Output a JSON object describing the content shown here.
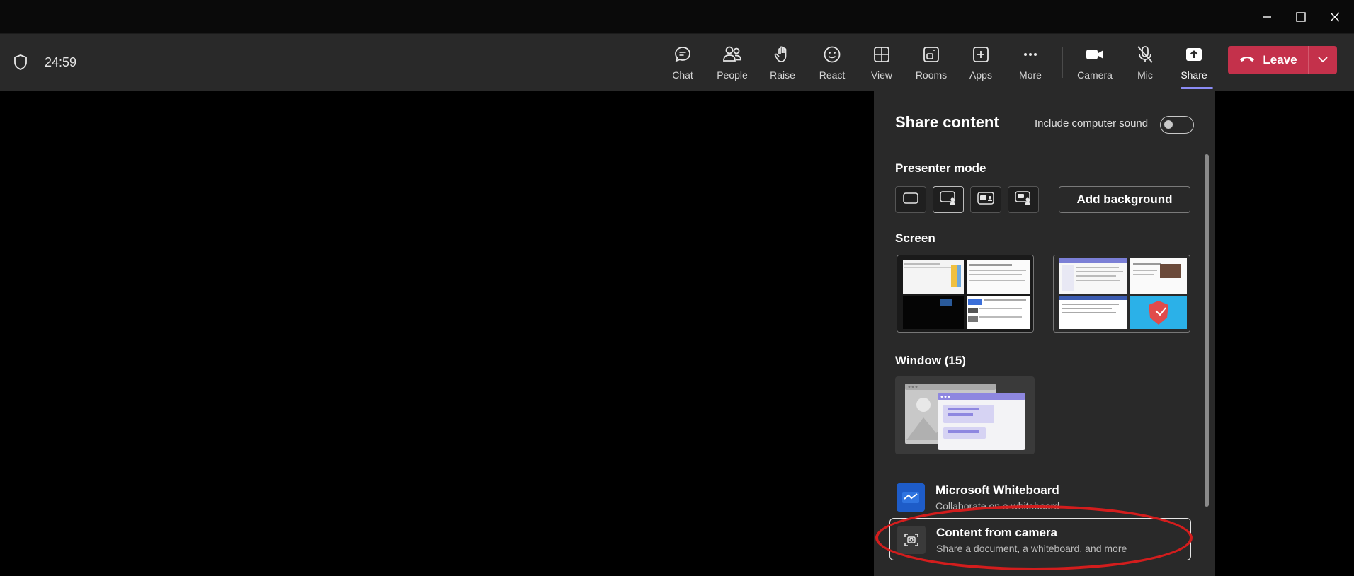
{
  "window": {
    "controls": [
      "minimize-icon",
      "maximize-icon",
      "close-icon"
    ]
  },
  "meeting": {
    "timer": "24:59"
  },
  "toolbar": {
    "items": [
      {
        "label": "Chat",
        "icon": "chat-icon"
      },
      {
        "label": "People",
        "icon": "people-icon"
      },
      {
        "label": "Raise",
        "icon": "raise-hand-icon"
      },
      {
        "label": "React",
        "icon": "react-icon"
      },
      {
        "label": "View",
        "icon": "view-icon"
      },
      {
        "label": "Rooms",
        "icon": "rooms-icon"
      },
      {
        "label": "Apps",
        "icon": "apps-icon"
      },
      {
        "label": "More",
        "icon": "more-icon"
      },
      {
        "label": "Camera",
        "icon": "camera-icon"
      },
      {
        "label": "Mic",
        "icon": "mic-off-icon"
      },
      {
        "label": "Share",
        "icon": "share-icon",
        "active": true
      }
    ],
    "leave_label": "Leave",
    "leave_color": "#c4314b",
    "accent": "#8b8cf5"
  },
  "share_panel": {
    "title": "Share content",
    "include_sound_label": "Include computer sound",
    "include_sound_on": false,
    "presenter_mode_label": "Presenter mode",
    "add_background_label": "Add background",
    "screen_label": "Screen",
    "window_label": "Window (15)",
    "options": [
      {
        "title": "Microsoft Whiteboard",
        "subtitle": "Collaborate on a whiteboard",
        "icon": "whiteboard-icon"
      },
      {
        "title": "Content from camera",
        "subtitle": "Share a document, a whiteboard, and more",
        "icon": "camera-content-icon"
      }
    ]
  }
}
